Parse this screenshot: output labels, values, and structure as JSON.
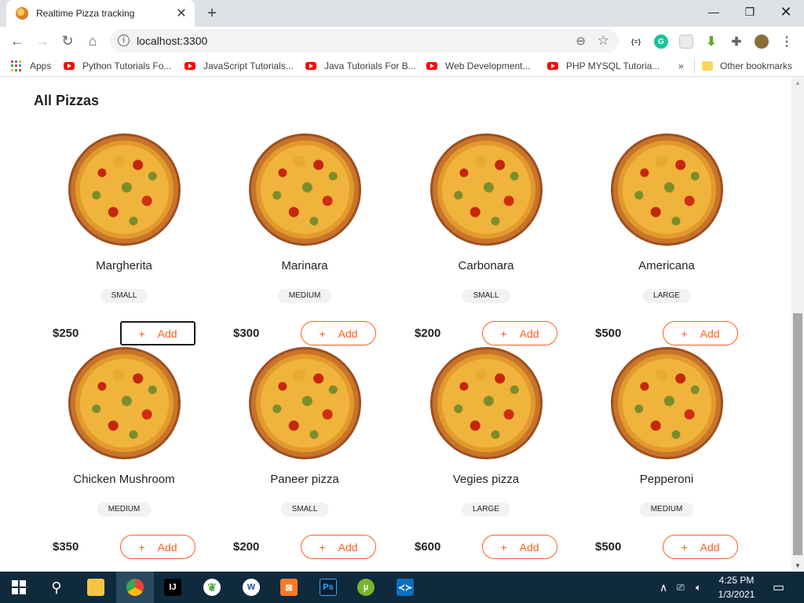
{
  "browser": {
    "tab_title": "Realtime Pizza tracking",
    "url": "localhost:3300",
    "bookmarks": {
      "apps_label": "Apps",
      "items": [
        "Python Tutorials Fo...",
        "JavaScript Tutorials...",
        "Java Tutorials For B...",
        "Web Development...",
        "PHP MYSQL Tutoria..."
      ],
      "overflow": "»",
      "other": "Other bookmarks"
    }
  },
  "page": {
    "section_title": "All Pizzas",
    "add_label": "Add",
    "add_symbol": "+",
    "pizzas": [
      {
        "name": "Margherita",
        "size": "SMALL",
        "price": "$250"
      },
      {
        "name": "Marinara",
        "size": "MEDIUM",
        "price": "$300"
      },
      {
        "name": "Carbonara",
        "size": "SMALL",
        "price": "$200"
      },
      {
        "name": "Americana",
        "size": "LARGE",
        "price": "$500"
      },
      {
        "name": "Chicken Mushroom",
        "size": "MEDIUM",
        "price": "$350"
      },
      {
        "name": "Paneer pizza",
        "size": "SMALL",
        "price": "$200"
      },
      {
        "name": "Vegies pizza",
        "size": "LARGE",
        "price": "$600"
      },
      {
        "name": "Pepperoni",
        "size": "MEDIUM",
        "price": "$500"
      }
    ]
  },
  "taskbar": {
    "time": "4:25 PM",
    "date": "1/3/2021"
  },
  "colors": {
    "accent": "#fe5f1e",
    "taskbar": "#102a3d"
  }
}
